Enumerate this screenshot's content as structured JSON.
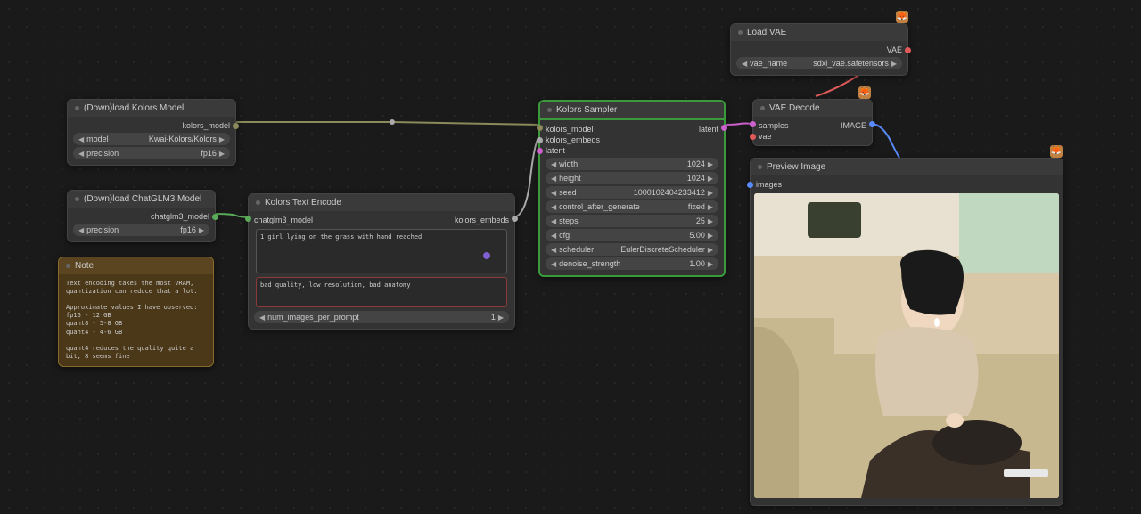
{
  "nodes": {
    "kolors_model": {
      "title": "(Down)load Kolors Model",
      "output": "kolors_model",
      "widgets": {
        "model": {
          "label": "model",
          "value": "Kwai-Kolors/Kolors"
        },
        "precision": {
          "label": "precision",
          "value": "fp16"
        }
      }
    },
    "chatglm_model": {
      "title": "(Down)load ChatGLM3 Model",
      "output": "chatglm3_model",
      "widgets": {
        "precision": {
          "label": "precision",
          "value": "fp16"
        }
      }
    },
    "note": {
      "title": "Note",
      "text": "Text encoding takes the most VRAM, quantization can reduce that a lot.\n\nApproximate values I have observed:\nfp16 - 12 GB\nquant8 - 5-8 GB\nquant4 - 4-6 GB\n\nquant4 reduces the quality quite a bit, 8 seems fine"
    },
    "text_encode": {
      "title": "Kolors Text Encode",
      "input": "chatglm3_model",
      "output": "kolors_embeds",
      "prompt": "1 girl lying on the grass with hand reached",
      "negative": "bad quality, low resolution, bad anatomy",
      "widgets": {
        "num_images": {
          "label": "num_images_per_prompt",
          "value": "1"
        }
      }
    },
    "sampler": {
      "title": "Kolors Sampler",
      "inputs": {
        "model": "kolors_model",
        "embeds": "kolors_embeds",
        "latent": "latent"
      },
      "output": "latent",
      "widgets": {
        "width": {
          "label": "width",
          "value": "1024"
        },
        "height": {
          "label": "height",
          "value": "1024"
        },
        "seed": {
          "label": "seed",
          "value": "1000102404233412"
        },
        "control": {
          "label": "control_after_generate",
          "value": "fixed"
        },
        "steps": {
          "label": "steps",
          "value": "25"
        },
        "cfg": {
          "label": "cfg",
          "value": "5.00"
        },
        "scheduler": {
          "label": "scheduler",
          "value": "EulerDiscreteScheduler"
        },
        "denoise": {
          "label": "denoise_strength",
          "value": "1.00"
        }
      }
    },
    "load_vae": {
      "title": "Load VAE",
      "output": "VAE",
      "widgets": {
        "vae_name": {
          "label": "vae_name",
          "value": "sdxl_vae.safetensors"
        }
      }
    },
    "vae_decode": {
      "title": "VAE Decode",
      "inputs": {
        "samples": "samples",
        "vae": "vae"
      },
      "output": "IMAGE"
    },
    "preview": {
      "title": "Preview Image",
      "input": "images"
    }
  }
}
